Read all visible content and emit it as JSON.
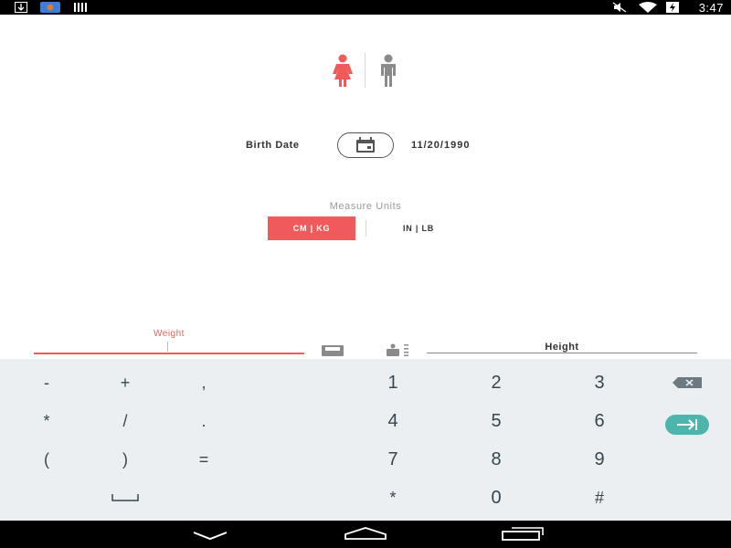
{
  "status_bar": {
    "time": "3:47",
    "left_icons": [
      "download-icon",
      "app-icon",
      "barcode-icon"
    ],
    "right_icons": [
      "mute-icon",
      "wifi-icon",
      "battery-charging-icon"
    ]
  },
  "gender": {
    "selected": "female",
    "options": [
      "female",
      "male"
    ],
    "colors": {
      "selected": "#f05a5a",
      "unselected": "#8a8a8a"
    }
  },
  "birth_date": {
    "label": "Birth Date",
    "value": "11/20/1990"
  },
  "measure_units": {
    "title": "Measure Units",
    "options": [
      "CM | KG",
      "IN | LB"
    ],
    "selected": "CM | KG"
  },
  "weight": {
    "label": "Weight",
    "value": ""
  },
  "height": {
    "label": "Height",
    "value": ""
  },
  "keyboard": {
    "symbols": [
      "-",
      "+",
      ",",
      "*",
      "/",
      ".",
      "(",
      ")",
      "="
    ],
    "space_label": "␣",
    "digits": [
      "1",
      "2",
      "3",
      "4",
      "5",
      "6",
      "7",
      "8",
      "9",
      "*",
      "0",
      "#"
    ]
  },
  "colors": {
    "accent": "#f05a5a",
    "next_key": "#4db6ac"
  }
}
